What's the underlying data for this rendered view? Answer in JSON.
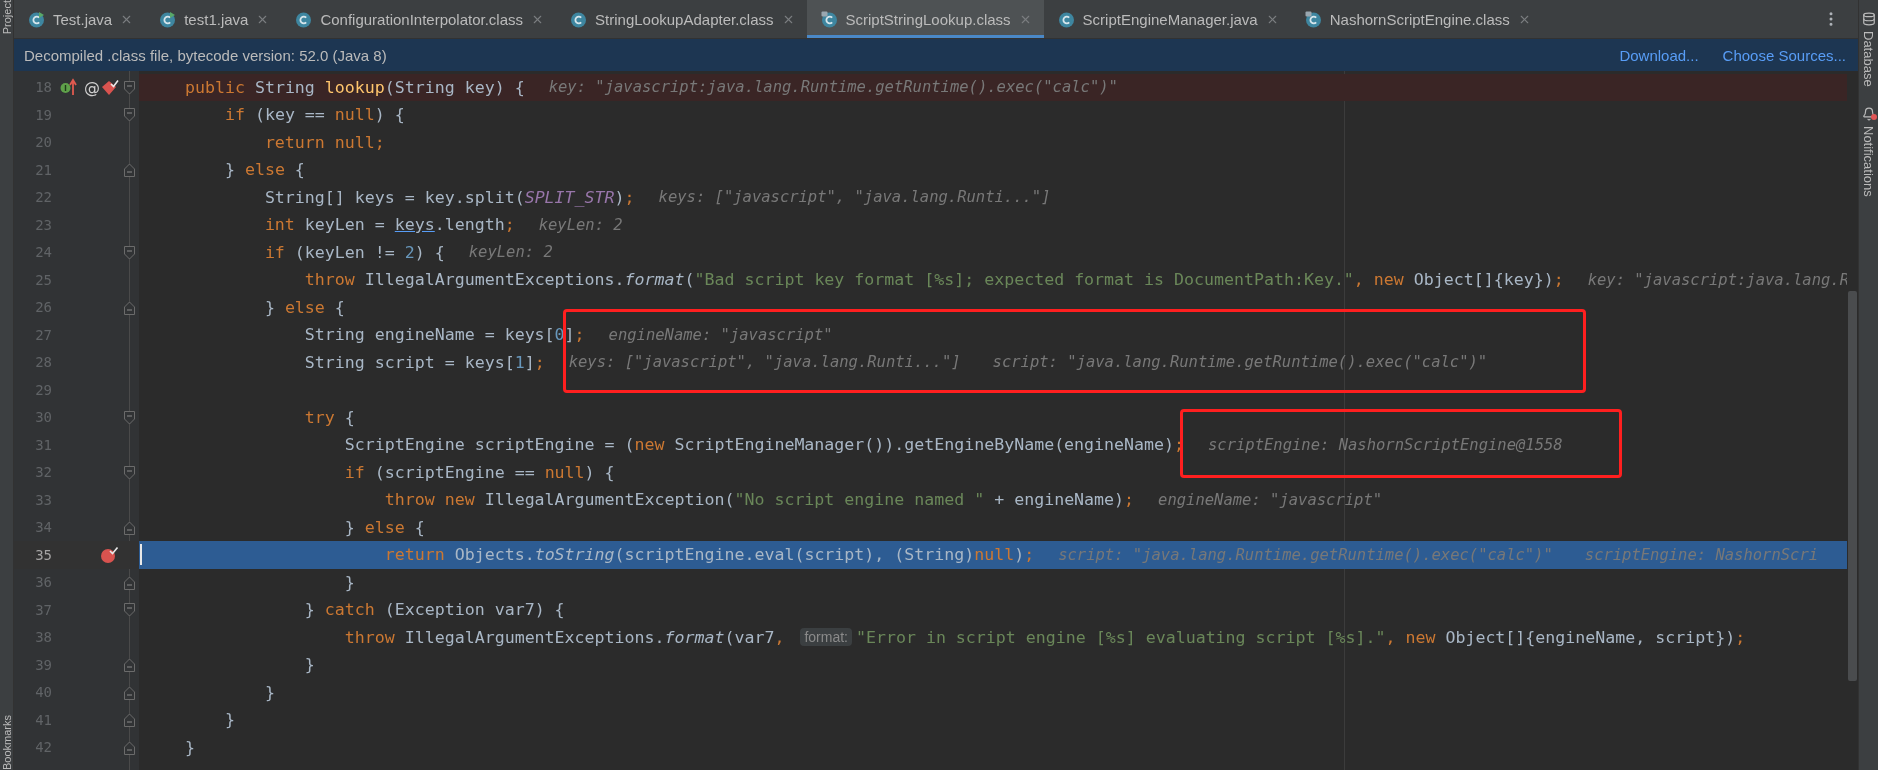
{
  "left_strip": {
    "top_label": "Project",
    "bottom_label": "Bookmarks"
  },
  "right_strip": [
    {
      "kind": "database",
      "label": "Database",
      "alert": false
    },
    {
      "kind": "notifications",
      "label": "Notifications",
      "alert": true
    }
  ],
  "tabs": [
    {
      "label": "Test.java",
      "kind": "java-runnable",
      "selected": false
    },
    {
      "label": "test1.java",
      "kind": "java-runnable",
      "selected": false
    },
    {
      "label": "ConfigurationInterpolator.class",
      "kind": "class",
      "selected": false
    },
    {
      "label": "StringLookupAdapter.class",
      "kind": "class",
      "selected": false
    },
    {
      "label": "ScriptStringLookup.class",
      "kind": "class-decompiled",
      "selected": true
    },
    {
      "label": "ScriptEngineManager.java",
      "kind": "class",
      "selected": false
    },
    {
      "label": "NashornScriptEngine.class",
      "kind": "class-decompiled",
      "selected": false
    }
  ],
  "banner": {
    "text": "Decompiled .class file, bytecode version: 52.0 (Java 8)",
    "links": [
      "Download...",
      "Choose Sources..."
    ]
  },
  "lines": [
    {
      "number": "18",
      "current": false,
      "breakpoint": {
        "kind": "method"
      },
      "fold": {
        "kind": "open"
      },
      "markers": [
        {
          "kind": "implements"
        },
        {
          "kind": "glyph",
          "text": "@"
        }
      ],
      "segments": [
        {
          "kind": "code",
          "tokens": [
            {
              "kind": "keyword",
              "text": "    public "
            },
            {
              "kind": "plain",
              "text": "String "
            },
            {
              "kind": "declaration",
              "text": "lookup"
            },
            {
              "kind": "plain",
              "text": "(String key) {"
            }
          ]
        },
        {
          "kind": "hint",
          "text": "key: \"javascript:java.lang.Runtime.getRuntime().exec(\"calc\")\""
        }
      ]
    },
    {
      "number": "19",
      "current": false,
      "fold": {
        "kind": "open"
      },
      "segments": [
        {
          "kind": "code",
          "tokens": [
            {
              "kind": "keyword",
              "text": "        if "
            },
            {
              "kind": "plain",
              "text": "(key == "
            },
            {
              "kind": "keyword",
              "text": "null"
            },
            {
              "kind": "plain",
              "text": ") {"
            }
          ]
        }
      ]
    },
    {
      "number": "20",
      "current": false,
      "segments": [
        {
          "kind": "code",
          "tokens": [
            {
              "kind": "keyword",
              "text": "            return null;"
            }
          ]
        }
      ]
    },
    {
      "number": "21",
      "current": false,
      "fold": {
        "kind": "close"
      },
      "segments": [
        {
          "kind": "code",
          "tokens": [
            {
              "kind": "plain",
              "text": "        } "
            },
            {
              "kind": "keyword",
              "text": "else "
            },
            {
              "kind": "plain",
              "text": "{"
            }
          ]
        }
      ]
    },
    {
      "number": "22",
      "current": false,
      "segments": [
        {
          "kind": "code",
          "tokens": [
            {
              "kind": "plain",
              "text": "            String[] keys = key.split("
            },
            {
              "kind": "constant",
              "text": "SPLIT_STR"
            },
            {
              "kind": "plain",
              "text": ")"
            },
            {
              "kind": "keyword",
              "text": ";"
            }
          ]
        },
        {
          "kind": "hint",
          "text": "keys: [\"javascript\", \"java.lang.Runti...\"]"
        }
      ]
    },
    {
      "number": "23",
      "current": false,
      "segments": [
        {
          "kind": "code",
          "tokens": [
            {
              "kind": "keyword",
              "text": "            int "
            },
            {
              "kind": "plain",
              "text": "keyLen = "
            },
            {
              "kind": "link",
              "text": "keys"
            },
            {
              "kind": "plain",
              "text": ".length"
            },
            {
              "kind": "keyword",
              "text": ";"
            }
          ]
        },
        {
          "kind": "hint",
          "text": "keyLen: 2"
        }
      ]
    },
    {
      "number": "24",
      "current": false,
      "fold": {
        "kind": "open"
      },
      "segments": [
        {
          "kind": "code",
          "tokens": [
            {
              "kind": "keyword",
              "text": "            if "
            },
            {
              "kind": "plain",
              "text": "(keyLen != "
            },
            {
              "kind": "number",
              "text": "2"
            },
            {
              "kind": "plain",
              "text": ") {"
            }
          ]
        },
        {
          "kind": "hint",
          "text": "keyLen: 2"
        }
      ]
    },
    {
      "number": "25",
      "current": false,
      "segments": [
        {
          "kind": "code",
          "tokens": [
            {
              "kind": "keyword",
              "text": "                throw "
            },
            {
              "kind": "plain",
              "text": "IllegalArgumentExceptions."
            },
            {
              "kind": "static",
              "text": "format"
            },
            {
              "kind": "plain",
              "text": "("
            },
            {
              "kind": "string",
              "text": "\"Bad script key format [%s]; expected format is DocumentPath:Key.\""
            },
            {
              "kind": "keyword",
              "text": ", new "
            },
            {
              "kind": "plain",
              "text": "Object[]{key})"
            },
            {
              "kind": "keyword",
              "text": ";"
            }
          ]
        },
        {
          "kind": "hint",
          "text": "key: \"javascript:java.lang.R"
        }
      ]
    },
    {
      "number": "26",
      "current": false,
      "fold": {
        "kind": "close"
      },
      "segments": [
        {
          "kind": "code",
          "tokens": [
            {
              "kind": "plain",
              "text": "            } "
            },
            {
              "kind": "keyword",
              "text": "else "
            },
            {
              "kind": "plain",
              "text": "{"
            }
          ]
        }
      ]
    },
    {
      "number": "27",
      "current": false,
      "annotation": {
        "kind": "red-frame"
      },
      "segments": [
        {
          "kind": "code",
          "tokens": [
            {
              "kind": "plain",
              "text": "                String engineName = keys["
            },
            {
              "kind": "number",
              "text": "0"
            },
            {
              "kind": "plain",
              "text": "]"
            },
            {
              "kind": "keyword",
              "text": ";"
            }
          ]
        },
        {
          "kind": "hint",
          "text": "engineName: \"javascript\""
        }
      ]
    },
    {
      "number": "28",
      "current": false,
      "annotation": {
        "kind": "red-frame"
      },
      "segments": [
        {
          "kind": "code",
          "tokens": [
            {
              "kind": "plain",
              "text": "                String script = keys["
            },
            {
              "kind": "number",
              "text": "1"
            },
            {
              "kind": "plain",
              "text": "]"
            },
            {
              "kind": "keyword",
              "text": ";"
            }
          ]
        },
        {
          "kind": "hint",
          "text": "keys: [\"javascript\", \"java.lang.Runti...\"]"
        },
        {
          "kind": "hint",
          "text": "script: \"java.lang.Runtime.getRuntime().exec(\"calc\")\""
        }
      ]
    },
    {
      "number": "29",
      "current": false
    },
    {
      "number": "30",
      "current": false,
      "fold": {
        "kind": "open"
      },
      "segments": [
        {
          "kind": "code",
          "tokens": [
            {
              "kind": "keyword",
              "text": "                try "
            },
            {
              "kind": "plain",
              "text": "{"
            }
          ]
        }
      ]
    },
    {
      "number": "31",
      "current": false,
      "annotation": {
        "kind": "red-frame"
      },
      "segments": [
        {
          "kind": "code",
          "tokens": [
            {
              "kind": "plain",
              "text": "                    ScriptEngine scriptEngine = ("
            },
            {
              "kind": "keyword",
              "text": "new "
            },
            {
              "kind": "plain",
              "text": "ScriptEngineManager()).getEngineByName(engineName)"
            },
            {
              "kind": "keyword",
              "text": ";"
            }
          ]
        },
        {
          "kind": "hint",
          "text": "scriptEngine: NashornScriptEngine@1558"
        }
      ]
    },
    {
      "number": "32",
      "current": false,
      "fold": {
        "kind": "open"
      },
      "segments": [
        {
          "kind": "code",
          "tokens": [
            {
              "kind": "keyword",
              "text": "                    if "
            },
            {
              "kind": "plain",
              "text": "(scriptEngine == "
            },
            {
              "kind": "keyword",
              "text": "null"
            },
            {
              "kind": "plain",
              "text": ") {"
            }
          ]
        }
      ]
    },
    {
      "number": "33",
      "current": false,
      "segments": [
        {
          "kind": "code",
          "tokens": [
            {
              "kind": "keyword",
              "text": "                        throw new "
            },
            {
              "kind": "plain",
              "text": "IllegalArgumentException("
            },
            {
              "kind": "string",
              "text": "\"No script engine named \""
            },
            {
              "kind": "plain",
              "text": " + engineName)"
            },
            {
              "kind": "keyword",
              "text": ";"
            }
          ]
        },
        {
          "kind": "hint",
          "text": "engineName: \"javascript\""
        }
      ]
    },
    {
      "number": "34",
      "current": false,
      "fold": {
        "kind": "close"
      },
      "segments": [
        {
          "kind": "code",
          "tokens": [
            {
              "kind": "plain",
              "text": "                    } "
            },
            {
              "kind": "keyword",
              "text": "else "
            },
            {
              "kind": "plain",
              "text": "{"
            }
          ]
        }
      ]
    },
    {
      "number": "35",
      "current": true,
      "breakpoint": {
        "kind": "line"
      },
      "segments": [
        {
          "kind": "code",
          "tokens": [
            {
              "kind": "keyword",
              "text": "                        return "
            },
            {
              "kind": "plain",
              "text": "Objects."
            },
            {
              "kind": "static",
              "text": "toString"
            },
            {
              "kind": "plain",
              "text": "(scriptEngine.eval(script), (String)"
            },
            {
              "kind": "keyword",
              "text": "null"
            },
            {
              "kind": "plain",
              "text": ")"
            },
            {
              "kind": "keyword",
              "text": ";"
            }
          ]
        },
        {
          "kind": "hint",
          "text": "script: \"java.lang.Runtime.getRuntime().exec(\"calc\")\""
        },
        {
          "kind": "hint",
          "text": "scriptEngine: NashornScri"
        }
      ]
    },
    {
      "number": "36",
      "current": false,
      "fold": {
        "kind": "close"
      },
      "segments": [
        {
          "kind": "code",
          "tokens": [
            {
              "kind": "plain",
              "text": "                    }"
            }
          ]
        }
      ]
    },
    {
      "number": "37",
      "current": false,
      "fold": {
        "kind": "open"
      },
      "segments": [
        {
          "kind": "code",
          "tokens": [
            {
              "kind": "plain",
              "text": "                } "
            },
            {
              "kind": "keyword",
              "text": "catch "
            },
            {
              "kind": "plain",
              "text": "(Exception var7) {"
            }
          ]
        }
      ]
    },
    {
      "number": "38",
      "current": false,
      "segments": [
        {
          "kind": "code",
          "tokens": [
            {
              "kind": "keyword",
              "text": "                    throw "
            },
            {
              "kind": "plain",
              "text": "IllegalArgumentExceptions."
            },
            {
              "kind": "static",
              "text": "format"
            },
            {
              "kind": "plain",
              "text": "(var7"
            },
            {
              "kind": "keyword",
              "text": ", "
            }
          ]
        },
        {
          "kind": "param-hint",
          "text": "format:"
        },
        {
          "kind": "code",
          "tokens": [
            {
              "kind": "string",
              "text": "\"Error in script engine [%s] evaluating script [%s].\""
            },
            {
              "kind": "keyword",
              "text": ", new "
            },
            {
              "kind": "plain",
              "text": "Object[]{engineName, script})"
            },
            {
              "kind": "keyword",
              "text": ";"
            }
          ]
        }
      ]
    },
    {
      "number": "39",
      "current": false,
      "fold": {
        "kind": "close"
      },
      "segments": [
        {
          "kind": "code",
          "tokens": [
            {
              "kind": "plain",
              "text": "                }"
            }
          ]
        }
      ]
    },
    {
      "number": "40",
      "current": false,
      "fold": {
        "kind": "close"
      },
      "segments": [
        {
          "kind": "code",
          "tokens": [
            {
              "kind": "plain",
              "text": "            }"
            }
          ]
        }
      ]
    },
    {
      "number": "41",
      "current": false,
      "fold": {
        "kind": "close"
      },
      "segments": [
        {
          "kind": "code",
          "tokens": [
            {
              "kind": "plain",
              "text": "        }"
            }
          ]
        }
      ]
    },
    {
      "number": "42",
      "current": false,
      "fold": {
        "kind": "close"
      },
      "segments": [
        {
          "kind": "code",
          "tokens": [
            {
              "kind": "plain",
              "text": "    }"
            }
          ]
        }
      ]
    }
  ]
}
